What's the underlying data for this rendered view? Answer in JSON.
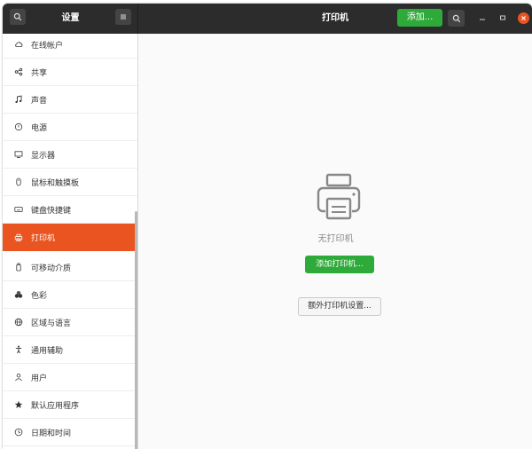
{
  "header": {
    "sidebar_title": "设置",
    "main_title": "打印机",
    "add_button": "添加..."
  },
  "sidebar": {
    "items": [
      {
        "label": "在线帐户",
        "icon": "cloud-icon"
      },
      {
        "label": "共享",
        "icon": "share-icon"
      },
      {
        "label": "声音",
        "icon": "music-note-icon"
      },
      {
        "label": "电源",
        "icon": "power-icon"
      },
      {
        "label": "显示器",
        "icon": "display-icon"
      },
      {
        "label": "鼠标和触摸板",
        "icon": "mouse-icon"
      },
      {
        "label": "键盘快捷键",
        "icon": "keyboard-icon"
      },
      {
        "label": "打印机",
        "icon": "printer-icon",
        "active": true
      },
      {
        "label": "可移动介质",
        "icon": "removable-media-icon"
      },
      {
        "label": "色彩",
        "icon": "color-icon"
      },
      {
        "label": "区域与语言",
        "icon": "globe-icon"
      },
      {
        "label": "通用辅助",
        "icon": "accessibility-icon"
      },
      {
        "label": "用户",
        "icon": "users-icon"
      },
      {
        "label": "默认应用程序",
        "icon": "star-icon"
      },
      {
        "label": "日期和时间",
        "icon": "clock-icon"
      }
    ]
  },
  "main": {
    "empty_text": "无打印机",
    "add_printer_button": "添加打印机...",
    "extra_settings_button": "额外打印机设置..."
  },
  "colors": {
    "accent": "#e95420",
    "suggested_action": "#2eaa3a",
    "headerbar": "#2c2c2c"
  }
}
